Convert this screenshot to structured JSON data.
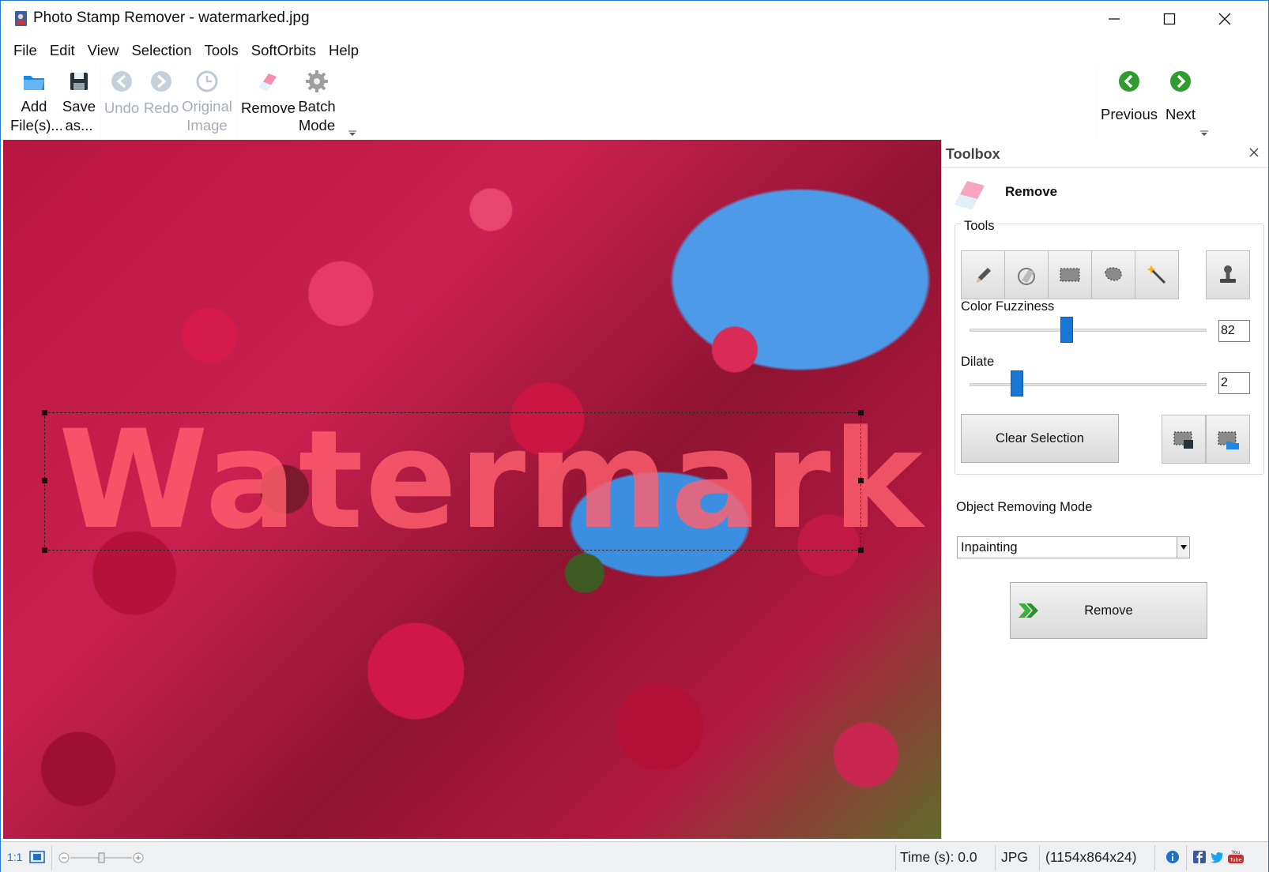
{
  "window": {
    "title": "Photo Stamp Remover - watermarked.jpg"
  },
  "menu": [
    "File",
    "Edit",
    "View",
    "Selection",
    "Tools",
    "SoftOrbits",
    "Help"
  ],
  "toolbar": {
    "add_files": [
      "Add",
      "File(s)..."
    ],
    "save_as": [
      "Save",
      "as..."
    ],
    "undo": "Undo",
    "redo": "Redo",
    "original_image": [
      "Original",
      "Image"
    ],
    "remove": "Remove",
    "batch_mode": [
      "Batch",
      "Mode"
    ],
    "previous": "Previous",
    "next": "Next"
  },
  "canvas": {
    "watermark_text": "Watermark"
  },
  "toolbox": {
    "title": "Toolbox",
    "section_title": "Remove",
    "tools_label": "Tools",
    "tool_icons": [
      "pencil-icon",
      "eraser-icon",
      "rect-select-icon",
      "lasso-icon",
      "magic-wand-icon",
      "stamp-icon"
    ],
    "color_fuzziness": {
      "label": "Color Fuzziness",
      "value": "82",
      "level": 0.41
    },
    "dilate": {
      "label": "Dilate",
      "value": "2",
      "level": 0.2
    },
    "clear_selection": "Clear Selection",
    "mode_label": "Object Removing Mode",
    "mode_value": "Inpainting",
    "remove_button": "Remove"
  },
  "status": {
    "zoom_label": "1:1",
    "time": "Time (s): 0.0",
    "format": "JPG",
    "dimensions": "(1154x864x24)"
  },
  "colors": {
    "accent": "#1976d2",
    "nav_green": "#2e9c2e",
    "watermark": "#ff5f6e"
  }
}
